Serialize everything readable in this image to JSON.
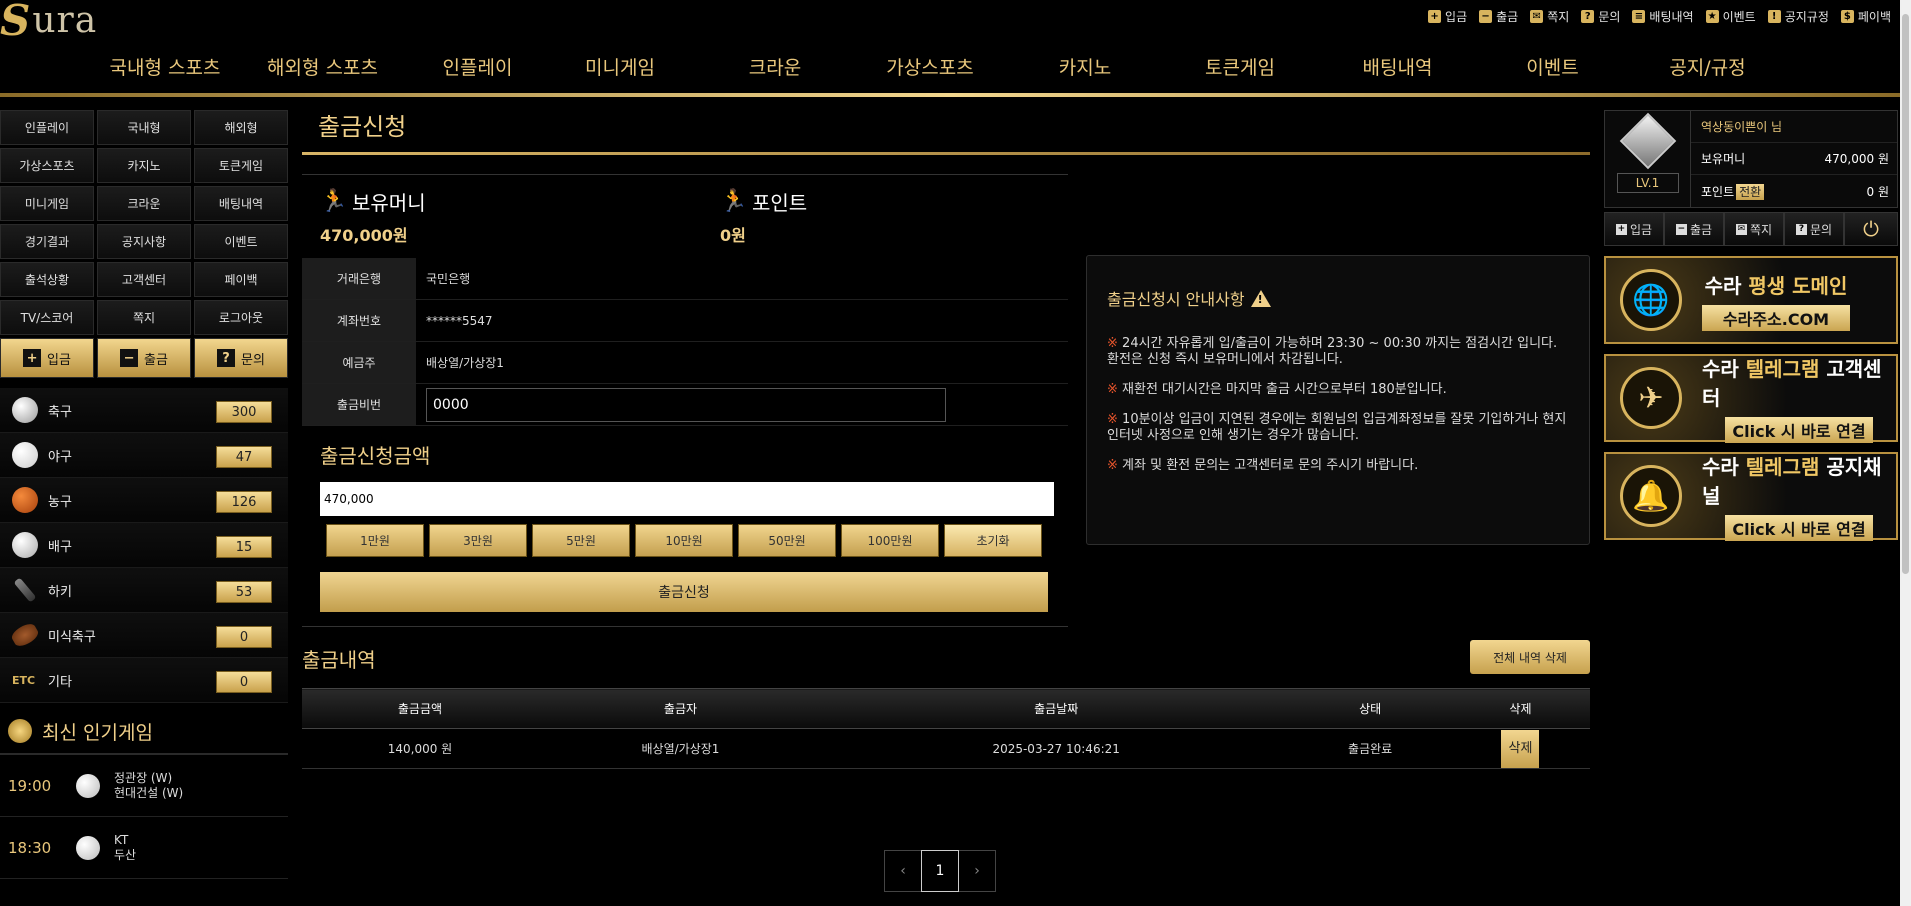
{
  "logo": {
    "s": "S",
    "rest": "ura"
  },
  "topnav": [
    {
      "icon": "plus-square-icon",
      "glyph": "+",
      "label": "입금"
    },
    {
      "icon": "minus-square-icon",
      "glyph": "−",
      "label": "출금"
    },
    {
      "icon": "person-icon",
      "glyph": "✉",
      "label": "쪽지"
    },
    {
      "icon": "question-icon",
      "glyph": "?",
      "label": "문의"
    },
    {
      "icon": "list-icon",
      "glyph": "≡",
      "label": "배팅내역"
    },
    {
      "icon": "gift-icon",
      "glyph": "★",
      "label": "이벤트"
    },
    {
      "icon": "megaphone-icon",
      "glyph": "!",
      "label": "공지규정"
    },
    {
      "icon": "moneybag-icon",
      "glyph": "$",
      "label": "페이백"
    }
  ],
  "mainnav": [
    "국내형 스포츠",
    "해외형 스포츠",
    "인플레이",
    "미니게임",
    "크라운",
    "가상스포츠",
    "카지노",
    "토큰게임",
    "배팅내역",
    "이벤트",
    "공지/규정"
  ],
  "quick": [
    "인플레이",
    "국내형",
    "해외형",
    "가상스포츠",
    "카지노",
    "토큰게임",
    "미니게임",
    "크라운",
    "배팅내역",
    "경기결과",
    "공지사항",
    "이벤트",
    "출석상황",
    "고객센터",
    "페이백",
    "TV/스코어",
    "쪽지",
    "로그아웃"
  ],
  "quick_gold": [
    {
      "glyph": "+",
      "label": "입금"
    },
    {
      "glyph": "−",
      "label": "출금"
    },
    {
      "glyph": "?",
      "label": "문의"
    }
  ],
  "sports": [
    {
      "name": "축구",
      "count": "300",
      "icon": "soccer-ball-icon",
      "color": "#e8e8e8"
    },
    {
      "name": "야구",
      "count": "47",
      "icon": "baseball-icon",
      "color": "#f2f2f2"
    },
    {
      "name": "농구",
      "count": "126",
      "icon": "basketball-icon",
      "color": "#d9621c"
    },
    {
      "name": "배구",
      "count": "15",
      "icon": "volleyball-icon",
      "color": "#e0e0e0"
    },
    {
      "name": "하키",
      "count": "53",
      "icon": "hockey-icon",
      "color": "#555555"
    },
    {
      "name": "미식축구",
      "count": "0",
      "icon": "football-icon",
      "color": "#8a4a22"
    },
    {
      "name": "기타",
      "count": "0",
      "icon": "etc-icon",
      "color": "#d8b45e",
      "etc": "ETC"
    }
  ],
  "popular": {
    "title": "최신 인기게임",
    "games": [
      {
        "time": "19:00",
        "home": "정관장 (W)",
        "away": "현대건설 (W)"
      },
      {
        "time": "18:30",
        "home": "KT",
        "away": "두산"
      }
    ]
  },
  "page_title": "출금신청",
  "balance": {
    "label": "보유머니",
    "value": "470,000원"
  },
  "point": {
    "label": "포인트",
    "value": "0원"
  },
  "form": {
    "bank_label": "거래은행",
    "bank_value": "국민은행",
    "account_label": "계좌번호",
    "account_value": "******5547",
    "holder_label": "예금주",
    "holder_value": "배상열/가상장1",
    "pw_label": "출금비번",
    "pw_value": "0000"
  },
  "amount": {
    "title": "출금신청금액",
    "value": "470,000",
    "buttons": [
      "1만원",
      "3만원",
      "5만원",
      "10만원",
      "50만원",
      "100만원",
      "초기화"
    ],
    "submit": "출금신청"
  },
  "notice": {
    "title": "출금신청시 안내사항",
    "mark": "※",
    "items": [
      "24시간 자유롭게 입/출금이 가능하며 23:30 ~ 00:30 까지는 점검시간 입니다. 환전은 신청 즉시 보유머니에서 차감됩니다.",
      "재환전 대기시간은 마지막 출금 시간으로부터 180분입니다.",
      "10분이상 입금이 지연된 경우에는 회원님의 입금계좌정보를 잘못 기입하거나 현지 인터넷 사정으로 인해 생기는 경우가 많습니다.",
      "계좌 및 환전 문의는 고객센터로 문의 주시기 바랍니다."
    ]
  },
  "history": {
    "title": "출금내역",
    "delete_all": "전체 내역 삭제",
    "columns": [
      "출금금액",
      "출금자",
      "출금날짜",
      "상태",
      "삭제"
    ],
    "rows": [
      {
        "amount": "140,000 원",
        "name": "배상열/가상장1",
        "date": "2025-03-27 10:46:21",
        "status": "출금완료",
        "del": "삭제"
      }
    ]
  },
  "pager": {
    "prev": "‹",
    "current": "1",
    "next": "›"
  },
  "user": {
    "level": "LV.1",
    "name": "역상동이쁜이 님",
    "money_label": "보유머니",
    "money_value": "470,000 원",
    "point_label": "포인트",
    "point_convert": "전환",
    "point_value": "0 원"
  },
  "user_buttons": [
    {
      "glyph": "+",
      "label": "입금"
    },
    {
      "glyph": "−",
      "label": "출금"
    },
    {
      "glyph": "✉",
      "label": "쪽지"
    },
    {
      "glyph": "?",
      "label": "문의"
    }
  ],
  "power_glyph": "⏻",
  "banners": [
    {
      "icon": "globe-icon",
      "glyph": "🌐",
      "t1a": "수라 ",
      "t1b": "평생 도메인",
      "t2": "수라주소.COM"
    },
    {
      "icon": "telegram-icon",
      "glyph": "✈",
      "t1a": "수라 ",
      "t1b": "텔레그램",
      "t1c": " 고객센터",
      "t2": "Click 시 바로 연결"
    },
    {
      "icon": "bell-icon",
      "glyph": "🔔",
      "t1a": "수라 ",
      "t1b": "텔레그램",
      "t1c": " 공지채널",
      "t2": "Click 시 바로 연결"
    }
  ],
  "colors": {
    "gold": "#f0d08a",
    "accent_red": "#e7552c"
  }
}
